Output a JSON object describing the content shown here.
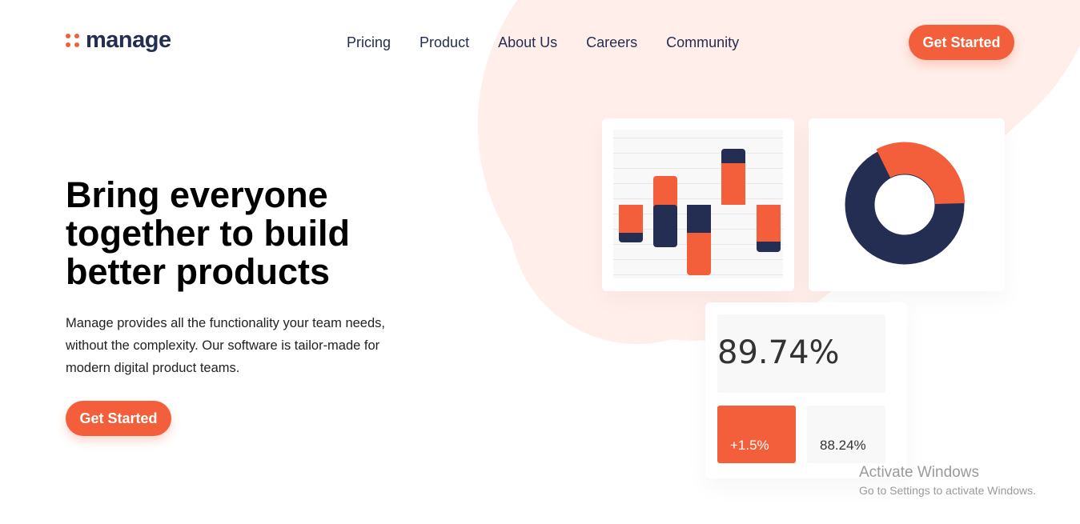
{
  "brand": {
    "name": "manage",
    "accent": "#f25f3a",
    "navy": "#242d52",
    "blush": "#ffeeea"
  },
  "nav": {
    "items": [
      "Pricing",
      "Product",
      "About Us",
      "Careers",
      "Community"
    ]
  },
  "header": {
    "cta_label": "Get Started"
  },
  "hero": {
    "headline": "Bring everyone together to build better products",
    "description": "Manage provides all the functionality your team needs, without the complexity. Our software is tailor-made for modern digital product teams.",
    "cta_label": "Get Started"
  },
  "dashboard": {
    "main_percent": "89.74%",
    "change": "+1.5%",
    "secondary_percent": "88.24%",
    "donut": {
      "orange_fraction": 0.27,
      "navy_fraction": 0.73
    }
  },
  "watermark": {
    "title": "Activate Windows",
    "subtitle": "Go to Settings to activate Windows."
  }
}
